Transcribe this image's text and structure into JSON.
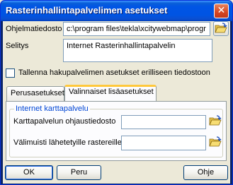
{
  "window": {
    "title": "Rasterinhallintapalvelimen asetukset",
    "close_glyph": "✕"
  },
  "fields": {
    "program_folder_label": "Ohjelmatiedosto",
    "program_folder_value": "c:\\program files\\tekla\\xcitywebmap\\progr",
    "description_label": "Selitys",
    "description_value": "Internet Rasterinhallintapalvelin"
  },
  "checkbox": {
    "label": "Tallenna hakupalvelimen asetukset erilliseen tiedostoon",
    "checked": false
  },
  "tabs": [
    {
      "label": "Perusasetukset",
      "active": false
    },
    {
      "label": "Valinnaiset lisäasetukset",
      "active": true
    }
  ],
  "group": {
    "title": "Internet karttapalvelu",
    "config_file_label": "Karttapalvelun ohjaustiedosto",
    "config_file_value": "",
    "cache_label": "Välimuisti lähetetyille rastereille",
    "cache_value": ""
  },
  "buttons": {
    "ok": "OK",
    "cancel": "Peru",
    "help": "Ohje"
  },
  "icons": {
    "folder": "folder-open-icon",
    "close": "close-icon"
  },
  "colors": {
    "title_bar": "#0054e3",
    "dialog_bg": "#ece9d8",
    "group_title": "#0046d5",
    "active_tab_accent": "#ffc83c"
  }
}
